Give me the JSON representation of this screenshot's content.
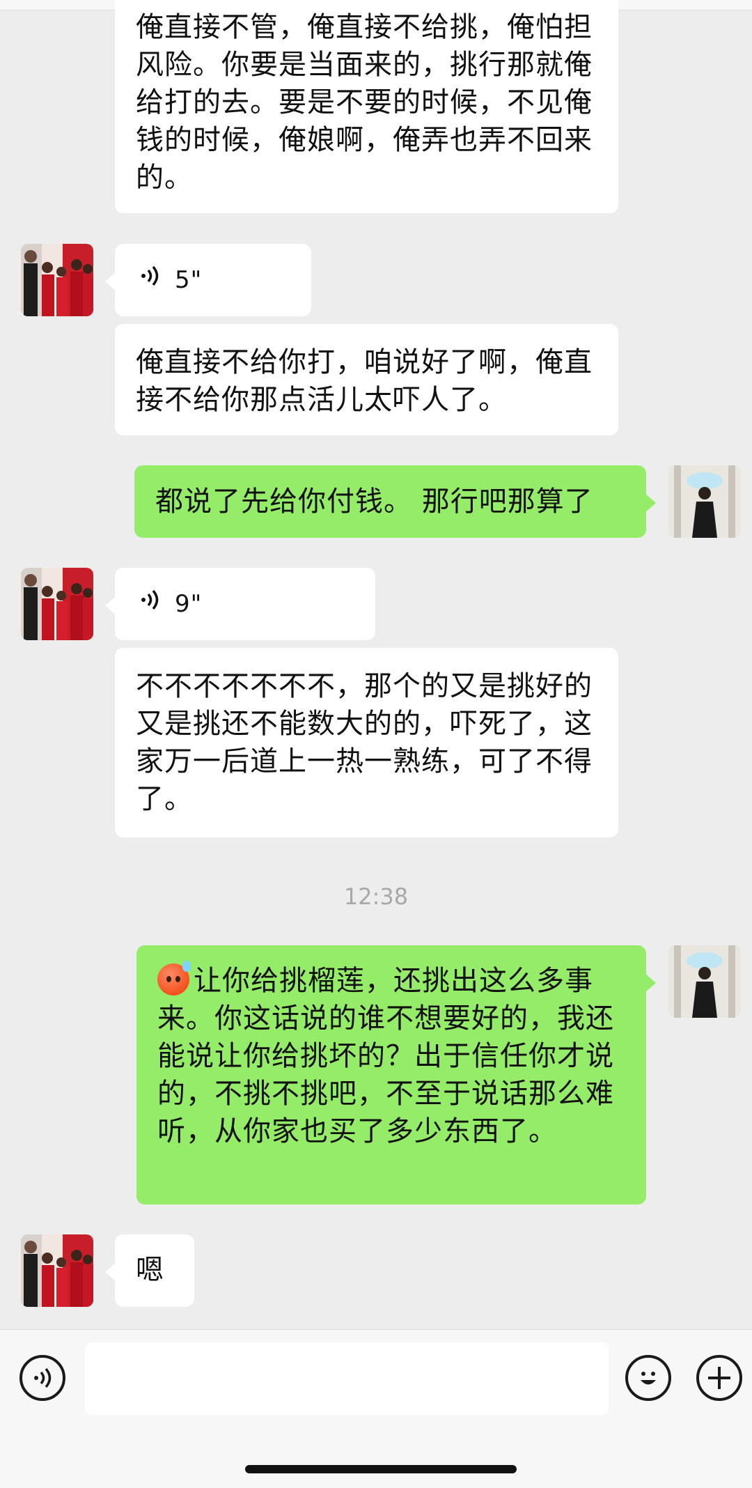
{
  "messages": [
    {
      "side": "received",
      "type": "text",
      "text": "俺直接不管，俺直接不给挑，俺怕担风险。你要是当面来的，挑行那就俺给打的去。要是不要的时候，不见俺钱的时候，俺娘啊，俺弄也弄不回来的。"
    },
    {
      "side": "received",
      "type": "voice",
      "duration": "5\""
    },
    {
      "side": "received",
      "type": "text",
      "text": "俺直接不给你打，咱说好了啊，俺直接不给你那点活儿太吓人了。"
    },
    {
      "side": "sent",
      "type": "text",
      "text": "都说了先给你付钱。 那行吧那算了"
    },
    {
      "side": "received",
      "type": "voice",
      "duration": "9\""
    },
    {
      "side": "received",
      "type": "text",
      "text": "不不不不不不不，那个的又是挑好的又是挑还不能数大的的，吓死了，这家万一后道上一热一熟练，可了不得了。"
    },
    {
      "side": "sent",
      "type": "text",
      "emoji": "sweat-face",
      "text": "让你给挑榴莲，还挑出这么多事来。你这话说的谁不想要好的，我还能说让你给挑坏的？出于信任你才说的，不挑不挑吧，不至于说话那么难听，从你家也买了多少东西了。"
    },
    {
      "side": "received",
      "type": "text",
      "text": "嗯"
    }
  ],
  "timestamp": "12:38",
  "colors": {
    "sent_bubble": "#95ec69",
    "received_bubble": "#ffffff",
    "background": "#ededed"
  },
  "input_bar": {
    "voice_icon": "voice-mode-icon",
    "emoji_icon": "emoji-icon",
    "plus_icon": "plus-icon",
    "text_value": ""
  }
}
